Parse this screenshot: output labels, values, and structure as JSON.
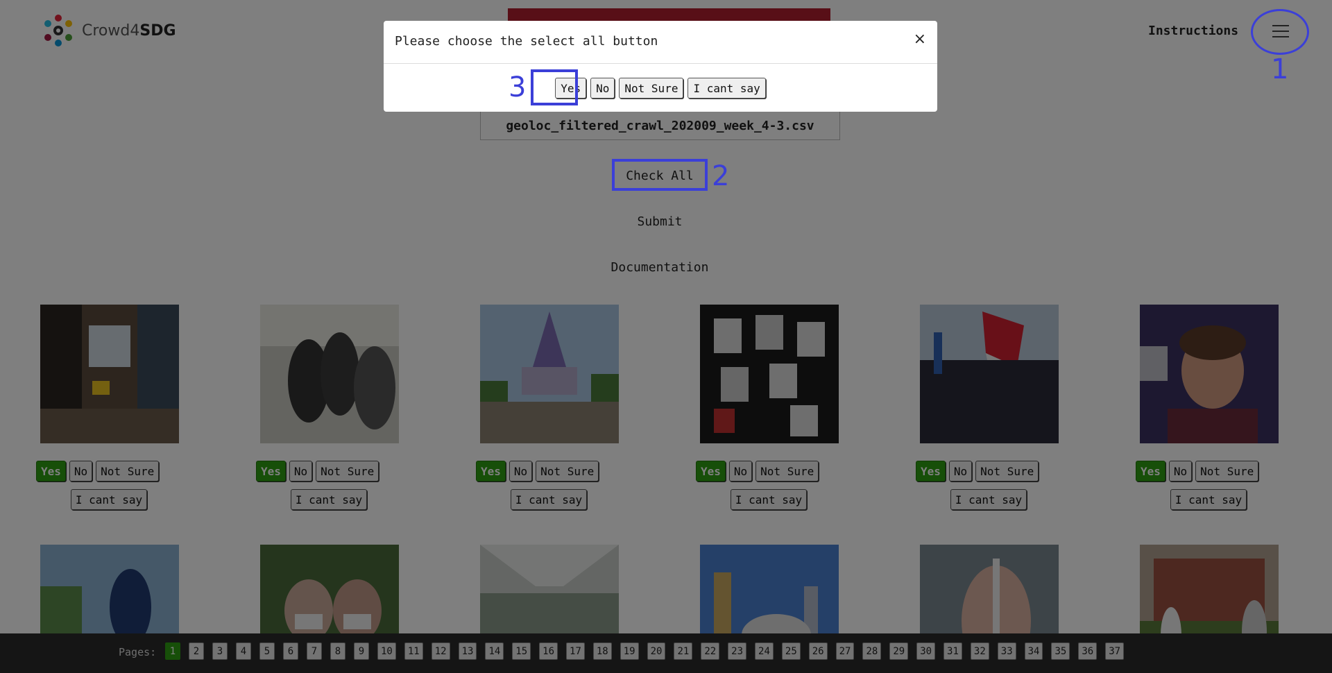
{
  "header": {
    "logo_text_prefix": "Crowd4",
    "logo_text_bold": "SDG",
    "instructions_label": "Instructions",
    "menu_icon": "hamburger-icon",
    "accent_red": "#b01f2e"
  },
  "main": {
    "file_name": "geoloc_filtered_crawl_202009_week_4-3.csv",
    "check_all_label": "Check All",
    "submit_label": "Submit",
    "documentation_label": "Documentation"
  },
  "card_options": {
    "yes": "Yes",
    "no": "No",
    "not_sure": "Not Sure",
    "cant_say": "I cant say",
    "selected": "Yes",
    "selected_color": "#2e9e12"
  },
  "images": [
    "street-scene-photo",
    "students-photo",
    "castle-crowd-photo",
    "masks-art-photo",
    "protest-crowd-photo",
    "smiling-man-photo",
    "worker-photo",
    "masked-men-photo",
    "train-interior-photo",
    "skyline-photo",
    "vaccine-photo",
    "garden-house-photo"
  ],
  "pagination": {
    "label": "Pages:",
    "pages": [
      "1",
      "2",
      "3",
      "4",
      "5",
      "6",
      "7",
      "8",
      "9",
      "10",
      "11",
      "12",
      "13",
      "14",
      "15",
      "16",
      "17",
      "18",
      "19",
      "20",
      "21",
      "22",
      "23",
      "24",
      "25",
      "26",
      "27",
      "28",
      "29",
      "30",
      "31",
      "32",
      "33",
      "34",
      "35",
      "36",
      "37"
    ],
    "current": "1"
  },
  "modal": {
    "title": "Please choose the select all button",
    "close": "×",
    "buttons": [
      "Yes",
      "No",
      "Not Sure",
      "I cant say"
    ]
  },
  "annotations": {
    "color": "#3b3fd8",
    "step_1": "1",
    "step_2": "2",
    "step_3": "3"
  }
}
